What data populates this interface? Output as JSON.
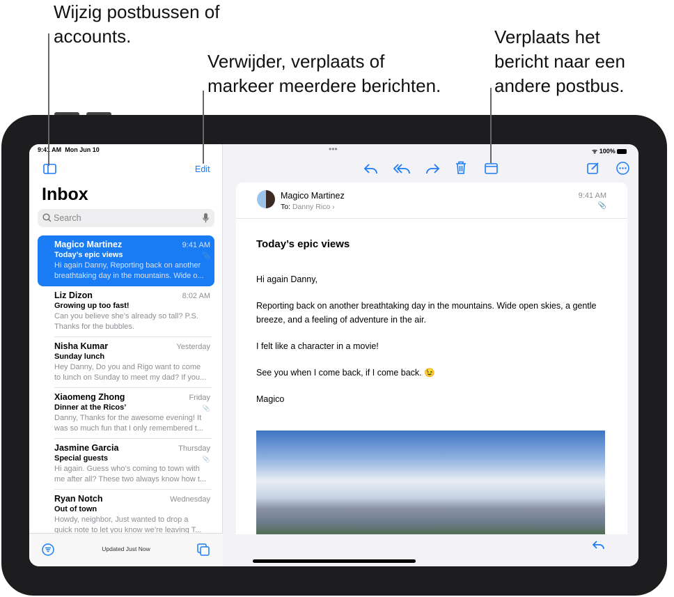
{
  "callouts": {
    "left": [
      "Wijzig postbussen of",
      "accounts."
    ],
    "middle": [
      "Verwijder, verplaats of",
      "markeer meerdere berichten."
    ],
    "right": [
      "Verplaats het",
      "bericht naar een",
      "andere postbus."
    ]
  },
  "status": {
    "time": "9:41 AM",
    "date": "Mon Jun 10",
    "battery": "100%"
  },
  "sidebar": {
    "edit_label": "Edit",
    "title": "Inbox",
    "search_placeholder": "Search",
    "updated": "Updated Just Now",
    "messages": [
      {
        "sender": "Magico Martinez",
        "time": "9:41 AM",
        "subject": "Today’s epic views",
        "preview1": "Hi again Danny, Reporting back on another",
        "preview2": "breathtaking day in the mountains. Wide o...",
        "attachment": true,
        "selected": true
      },
      {
        "sender": "Liz Dizon",
        "time": "8:02 AM",
        "subject": "Growing up too fast!",
        "preview1": "Can you believe she’s already so tall? P.S.",
        "preview2": "Thanks for the bubbles.",
        "attachment": false
      },
      {
        "sender": "Nisha Kumar",
        "time": "Yesterday",
        "subject": "Sunday lunch",
        "preview1": "Hey Danny, Do you and Rigo want to come",
        "preview2": "to lunch on Sunday to meet my dad? If you...",
        "attachment": false
      },
      {
        "sender": "Xiaomeng Zhong",
        "time": "Friday",
        "subject": "Dinner at the Ricos’",
        "preview1": "Danny, Thanks for the awesome evening! It",
        "preview2": "was so much fun that I only remembered t...",
        "attachment": true
      },
      {
        "sender": "Jasmine Garcia",
        "time": "Thursday",
        "subject": "Special guests",
        "preview1": "Hi again. Guess who’s coming to town with",
        "preview2": "me after all? These two always know how t...",
        "attachment": true
      },
      {
        "sender": "Ryan Notch",
        "time": "Wednesday",
        "subject": "Out of town",
        "preview1": "Howdy, neighbor, Just wanted to drop a",
        "preview2": "quick note to let you know we’re leaving T...",
        "attachment": false
      }
    ]
  },
  "message": {
    "sender": "Magico Martinez",
    "to_label": "To:",
    "to": "Danny Rico",
    "time": "9:41 AM",
    "subject": "Today’s epic views",
    "body": [
      "Hi again Danny,",
      "Reporting back on another breathtaking day in the mountains. Wide open skies, a gentle breeze, and a feeling of adventure in the air.",
      "I felt like a character in a movie!",
      "See you when I come back, if I come back. 😉",
      "Magico"
    ]
  },
  "colors": {
    "accent": "#1a7cf5",
    "frame": "#1d1d1f"
  }
}
